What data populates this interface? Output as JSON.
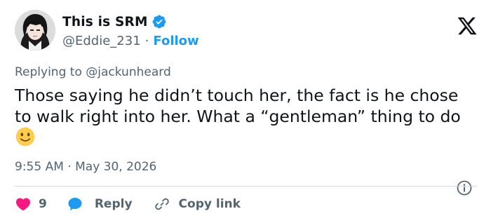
{
  "user": {
    "display_name": "This is SRM",
    "handle": "@Eddie_231",
    "separator": "·",
    "follow_label": "Follow"
  },
  "reply_context": {
    "prefix": "Replying to",
    "mention": "@jackunheard"
  },
  "tweet": {
    "text": "Those saying he didn’t touch her, the fact is he chose to walk right into her. What a “gentleman” thing to do",
    "emoji": "slightly-smiling-face-emoji"
  },
  "meta": {
    "time": "9:55 AM",
    "separator": "·",
    "date": "May 30, 2026"
  },
  "actions": {
    "like_count": "9",
    "reply_label": "Reply",
    "copy_link_label": "Copy link"
  },
  "colors": {
    "like": "#f91880",
    "reply": "#1d9bf0",
    "follow": "#1d9bf0",
    "verified": "#1d9bf0",
    "secondary_text": "#536471",
    "primary_text": "#0f1419",
    "divider": "#cfd9de"
  },
  "icons": {
    "brand": "x-logo-icon",
    "verified": "verified-badge-icon",
    "info": "info-icon",
    "like": "heart-icon",
    "reply": "speech-bubble-icon",
    "copy_link": "link-icon"
  }
}
